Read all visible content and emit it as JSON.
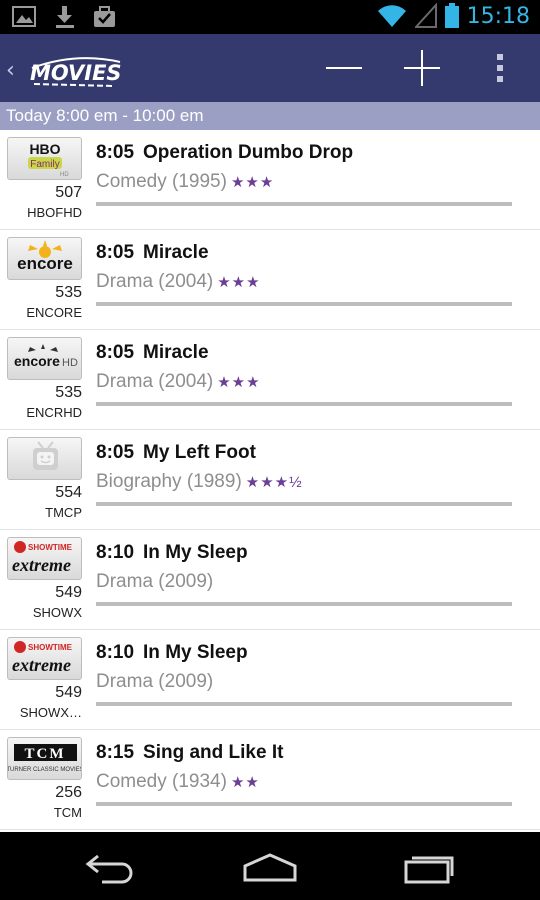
{
  "status_bar": {
    "time": "15:18",
    "icons": [
      "image-icon",
      "download-icon",
      "briefcase-check-icon",
      "wifi-icon",
      "signal-icon",
      "battery-icon"
    ],
    "accent": "#33b5e5"
  },
  "action_bar": {
    "logo_text": "MOVIES",
    "back_glyph": "‹",
    "background": "#353a6e",
    "buttons": [
      "zoom-out-button",
      "zoom-in-button",
      "overflow-menu-button"
    ]
  },
  "section_header": {
    "label": "Today 8:00 em - 10:00 em"
  },
  "listings": [
    {
      "channel_logo": "HBO Family HD",
      "channel_number": "507",
      "call_sign": "HBOFHD",
      "time": "8:05",
      "title": "Operation Dumbo Drop",
      "genre": "Comedy",
      "year": "(1995)",
      "stars": "★★★",
      "rating": 3,
      "progress": 0.0
    },
    {
      "channel_logo": "encore",
      "channel_number": "535",
      "call_sign": "ENCORE",
      "time": "8:05",
      "title": "Miracle",
      "genre": "Drama",
      "year": "(2004)",
      "stars": "★★★",
      "rating": 3,
      "progress": 0.0
    },
    {
      "channel_logo": "encore HD",
      "channel_number": "535",
      "call_sign": "ENCRHD",
      "time": "8:05",
      "title": "Miracle",
      "genre": "Drama",
      "year": "(2004)",
      "stars": "★★★",
      "rating": 3,
      "progress": 0.0
    },
    {
      "channel_logo": "tv",
      "channel_number": "554",
      "call_sign": "TMCP",
      "time": "8:05",
      "title": "My Left Foot",
      "genre": "Biography",
      "year": "(1989)",
      "stars": "★★★½",
      "rating": 3.5,
      "progress": 0.0
    },
    {
      "channel_logo": "Showtime Extreme",
      "channel_number": "549",
      "call_sign": "SHOWX",
      "time": "8:10",
      "title": "In My Sleep",
      "genre": "Drama",
      "year": "(2009)",
      "stars": "",
      "rating": 0,
      "progress": 0.0
    },
    {
      "channel_logo": "Showtime Extreme",
      "channel_number": "549",
      "call_sign": "SHOWX…",
      "time": "8:10",
      "title": "In My Sleep",
      "genre": "Drama",
      "year": "(2009)",
      "stars": "",
      "rating": 0,
      "progress": 0.0
    },
    {
      "channel_logo": "TCM Turner Classic Movies",
      "channel_number": "256",
      "call_sign": "TCM",
      "time": "8:15",
      "title": "Sing and Like It",
      "genre": "Comedy",
      "year": "(1934)",
      "stars": "★★",
      "rating": 2,
      "progress": 0.0
    }
  ],
  "nav_bar": {
    "buttons": [
      "back-nav-icon",
      "home-nav-icon",
      "recent-apps-icon"
    ]
  }
}
